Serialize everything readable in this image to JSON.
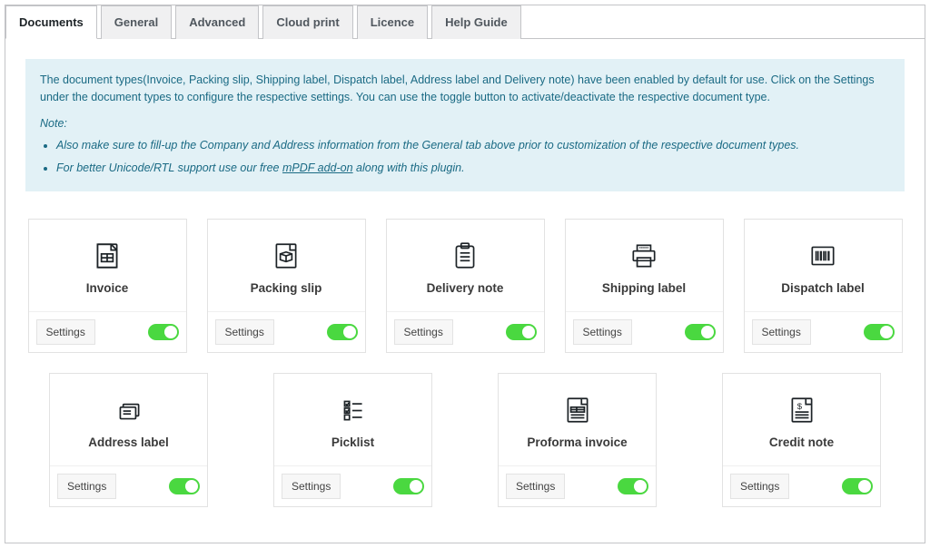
{
  "tabs": [
    {
      "label": "Documents",
      "active": true
    },
    {
      "label": "General",
      "active": false
    },
    {
      "label": "Advanced",
      "active": false
    },
    {
      "label": "Cloud print",
      "active": false
    },
    {
      "label": "Licence",
      "active": false
    },
    {
      "label": "Help Guide",
      "active": false
    }
  ],
  "notice": {
    "info": "The document types(Invoice, Packing slip, Shipping label, Dispatch label, Address label and Delivery note) have been enabled by default for use. Click on the Settings under the document types to configure the respective settings. You can use the toggle button to activate/deactivate the respective document type.",
    "note_label": "Note:",
    "bullets": [
      "Also make sure to fill-up the Company and Address information from the General tab above prior to customization of the respective document types."
    ],
    "bullet2_prefix": "For better Unicode/RTL support use our free ",
    "bullet2_link": "mPDF add-on",
    "bullet2_suffix": " along with this plugin."
  },
  "settings_label": "Settings",
  "documents_row1": [
    {
      "title": "Invoice",
      "icon": "invoice",
      "enabled": true
    },
    {
      "title": "Packing slip",
      "icon": "box",
      "enabled": true
    },
    {
      "title": "Delivery note",
      "icon": "clipboard",
      "enabled": true
    },
    {
      "title": "Shipping label",
      "icon": "printer",
      "enabled": true
    },
    {
      "title": "Dispatch label",
      "icon": "barcode",
      "enabled": true
    }
  ],
  "documents_row2": [
    {
      "title": "Address label",
      "icon": "labels",
      "enabled": true
    },
    {
      "title": "Picklist",
      "icon": "checklist",
      "enabled": true
    },
    {
      "title": "Proforma invoice",
      "icon": "proforma",
      "enabled": true
    },
    {
      "title": "Credit note",
      "icon": "creditnote",
      "enabled": true
    }
  ]
}
